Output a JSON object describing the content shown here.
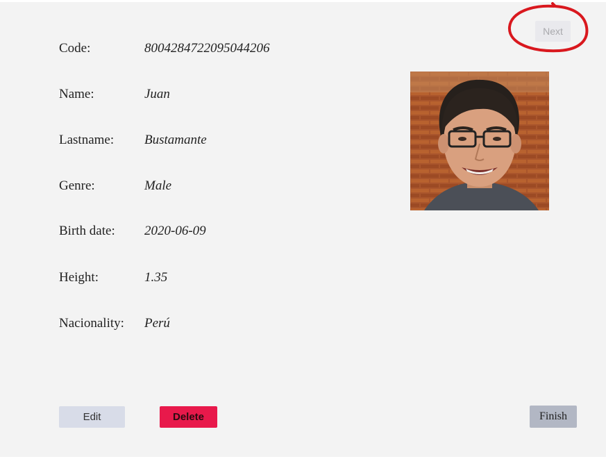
{
  "navigation": {
    "next_label": "Next",
    "finish_label": "Finish"
  },
  "actions": {
    "edit_label": "Edit",
    "delete_label": "Delete"
  },
  "person": {
    "fields": [
      {
        "label": "Code:",
        "value": "8004284722095044206"
      },
      {
        "label": "Name:",
        "value": "Juan"
      },
      {
        "label": "Lastname:",
        "value": "Bustamante"
      },
      {
        "label": "Genre:",
        "value": "Male"
      },
      {
        "label": "Birth date:",
        "value": "2020-06-09"
      },
      {
        "label": "Height:",
        "value": "1.35"
      },
      {
        "label": "Nacionality:",
        "value": "Perú"
      }
    ]
  },
  "colors": {
    "panel_background": "#f3f3f3",
    "edit_button": "#d8dce8",
    "delete_button": "#e8194b",
    "finish_button": "#b2b7c4",
    "next_button_disabled": "#e9e9ed",
    "annotation_circle": "#d9181e"
  }
}
